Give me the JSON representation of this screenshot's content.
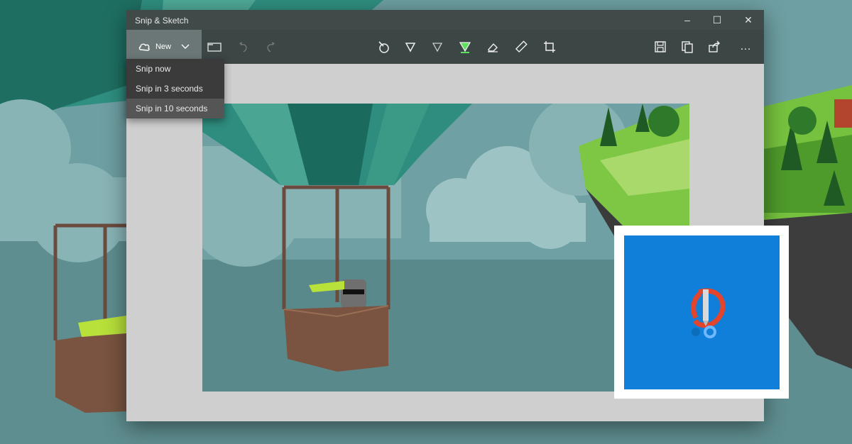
{
  "window": {
    "title": "Snip & Sketch",
    "controls": {
      "minimize": "–",
      "maximize": "☐",
      "close": "✕"
    }
  },
  "toolbar": {
    "new_label": "New",
    "icons": [
      "snip-icon",
      "chevron-down-icon",
      "folder-icon",
      "undo-icon",
      "redo-icon",
      "touch-writing-icon",
      "ballpoint-pen-icon",
      "pencil-icon",
      "highlighter-icon",
      "eraser-icon",
      "ruler-icon",
      "crop-icon",
      "save-icon",
      "copy-icon",
      "share-icon",
      "more-icon"
    ],
    "more_label": "…"
  },
  "new_menu": {
    "items": [
      "Snip now",
      "Snip in 3 seconds",
      "Snip in 10 seconds"
    ],
    "highlighted_index": 2
  },
  "colors": {
    "titlebar": "#3f4a49",
    "toolbar": "#3c4645",
    "highlighter_accent": "#5ee05a",
    "logo_blue": "#0f7fd9",
    "logo_red": "#e2452b"
  }
}
